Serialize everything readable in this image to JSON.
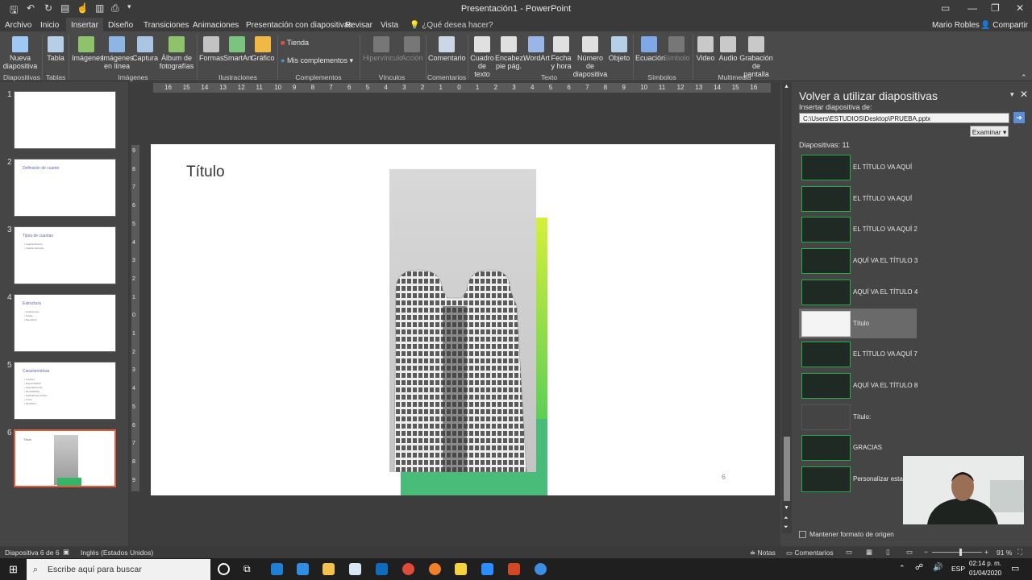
{
  "window": {
    "title": "Presentación1 - PowerPoint",
    "user": "Mario Robles",
    "share": "Compartir"
  },
  "tabs": [
    "Archivo",
    "Inicio",
    "Insertar",
    "Diseño",
    "Transiciones",
    "Animaciones",
    "Presentación con diapositivas",
    "Revisar",
    "Vista"
  ],
  "tell_me": "¿Qué desea hacer?",
  "ribbon": {
    "buttons": [
      {
        "label": "Nueva diapositiva",
        "color": "#9ec9f5"
      },
      {
        "label": "Tabla",
        "color": "#b5cfe8"
      },
      {
        "label": "Imágenes",
        "color": "#8dc36a"
      },
      {
        "label": "Imágenes en línea",
        "color": "#8db6e6"
      },
      {
        "label": "Captura",
        "color": "#a8c6e3"
      },
      {
        "label": "Álbum de fotografías",
        "color": "#8dc36a"
      },
      {
        "label": "Formas",
        "color": "#c3c3c3"
      },
      {
        "label": "SmartArt",
        "color": "#7bc47f"
      },
      {
        "label": "Gráfico",
        "color": "#f2b845"
      },
      {
        "label": "Hipervínculo",
        "color": "#8a8a8a"
      },
      {
        "label": "Acción",
        "color": "#8a8a8a"
      },
      {
        "label": "Comentario",
        "color": "#c9d7e8"
      },
      {
        "label": "Cuadro de texto",
        "color": "#e0e0e0"
      },
      {
        "label": "Encabez. pie pág.",
        "color": "#e0e0e0"
      },
      {
        "label": "WordArt",
        "color": "#9ab5e8"
      },
      {
        "label": "Fecha y hora",
        "color": "#e0e0e0"
      },
      {
        "label": "Número de diapositiva",
        "color": "#e0e0e0"
      },
      {
        "label": "Objeto",
        "color": "#b5cfe8"
      },
      {
        "label": "Ecuación",
        "color": "#7ea9e6"
      },
      {
        "label": "Símbolo",
        "color": "#8a8a8a"
      },
      {
        "label": "Video",
        "color": "#c9c9c9"
      },
      {
        "label": "Audio",
        "color": "#c9c9c9"
      },
      {
        "label": "Grabación de pantalla",
        "color": "#c9c9c9"
      }
    ],
    "store": "Tienda",
    "addins": "Mis complementos",
    "groups": [
      "Diapositivas",
      "Tablas",
      "Imágenes",
      "Ilustraciones",
      "Complementos",
      "Vínculos",
      "Comentarios",
      "Texto",
      "Símbolos",
      "Multimedia"
    ]
  },
  "thumbnails": [
    {
      "num": "1",
      "title": "",
      "lines": []
    },
    {
      "num": "2",
      "title": "Definición de cuanto",
      "lines": []
    },
    {
      "num": "3",
      "title": "Tipos de cuantas",
      "lines": [
        "• Cuanta Ahorros",
        "• Cuanta corriente"
      ]
    },
    {
      "num": "4",
      "title": "Estructura",
      "lines": [
        "• Instituciones",
        "• Tarifas",
        "• Beneficios"
      ]
    },
    {
      "num": "5",
      "title": "Características",
      "lines": [
        "• Liquidez",
        "• Disponibilidad",
        "• Seguridad total",
        "• Rentabilidad",
        "• Facilidad de cambio",
        "• Costo",
        "• Movilidad"
      ]
    },
    {
      "num": "6",
      "title": "Título",
      "lines": []
    }
  ],
  "slide": {
    "title": "Título",
    "number": "6",
    "accent": "#35b56a"
  },
  "ruler": {
    "h": [
      "16",
      "15",
      "14",
      "13",
      "12",
      "11",
      "10",
      "9",
      "8",
      "7",
      "6",
      "5",
      "4",
      "3",
      "2",
      "1",
      "0",
      "1",
      "2",
      "3",
      "4",
      "5",
      "6",
      "7",
      "8",
      "9",
      "10",
      "11",
      "12",
      "13",
      "14",
      "15",
      "16"
    ],
    "v": [
      "9",
      "8",
      "7",
      "6",
      "5",
      "4",
      "3",
      "2",
      "1",
      "0",
      "1",
      "2",
      "3",
      "4",
      "5",
      "6",
      "7",
      "8",
      "9"
    ]
  },
  "pane": {
    "title": "Volver a utilizar diapositivas",
    "insert_from": "Insertar diapositiva de:",
    "path": "C:\\Users\\ESTUDIOS\\Desktop\\PRUEBA.pptx",
    "browse": "Examinar",
    "count": "Diapositivas: 11",
    "slides": [
      "EL TÍTULO  VA AQUÍ",
      "EL TÍTULO VA AQUÍ",
      "EL TÍTULO VA AQUÍ 2",
      "AQUÍ VA EL TÍTULO 3",
      "AQUÍ VA EL TÍTULO 4",
      "Título",
      "EL TÍTULO VA AQUÍ 7",
      "AQUÍ VA EL TÍTULO 8",
      "Título:",
      "GRACIAS",
      "Personalizar esta..."
    ],
    "selected_index": 5,
    "keep_format": "Mantener formato de origen"
  },
  "status": {
    "slide_pos": "Diapositiva 6 de 6",
    "language": "Inglés (Estados Unidos)",
    "notes": "Notas",
    "comments": "Comentarios",
    "zoom": "91 %",
    "zoom_fraction": 0.56
  },
  "taskbar": {
    "search": "Escribe aquí para buscar",
    "lang": "ESP",
    "time": "02:14 p. m.",
    "date": "01/04/2020"
  }
}
